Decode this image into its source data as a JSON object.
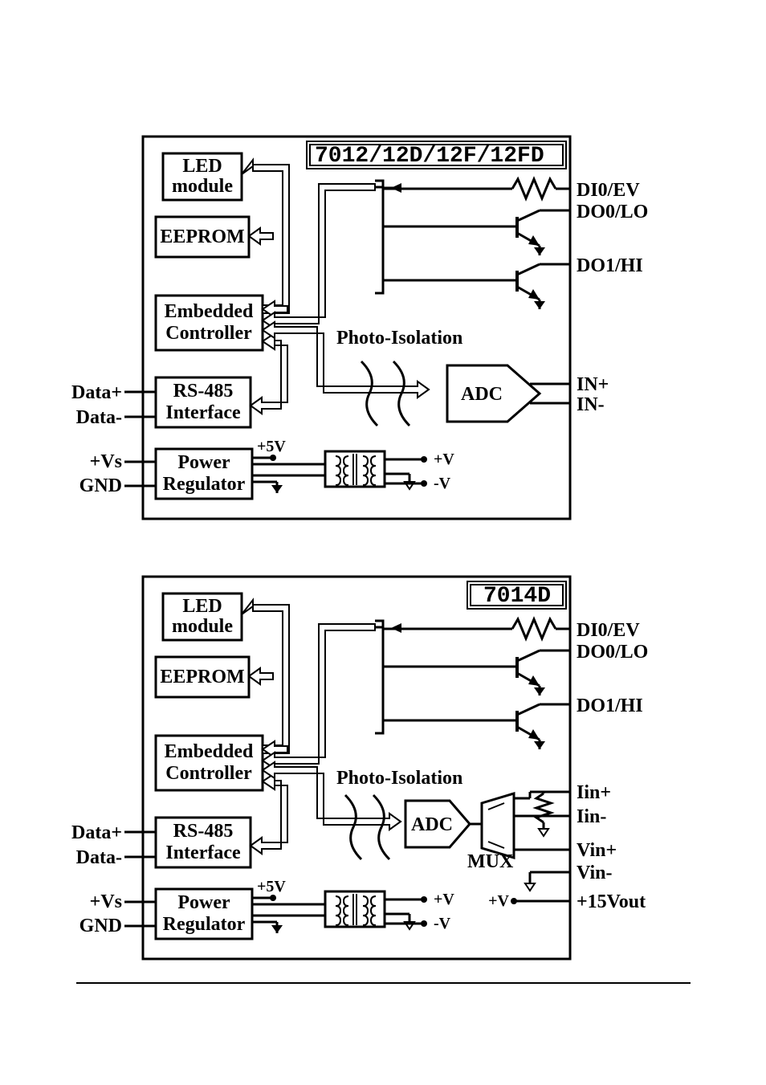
{
  "diagram1": {
    "title": "7012/12D/12F/12FD",
    "blocks": {
      "led": [
        "LED",
        "module"
      ],
      "eeprom": "EEPROM",
      "embedded": [
        "Embedded",
        "Controller"
      ],
      "rs485": [
        "RS-485",
        "Interface"
      ],
      "power": [
        "Power",
        "Regulator"
      ],
      "adc": "ADC",
      "photo": "Photo-Isolation"
    },
    "signals_left": {
      "data_p": "Data+",
      "data_n": "Data-",
      "vs_p": "+Vs",
      "gnd": "GND"
    },
    "signals_right": {
      "di0": "DI0/EV",
      "do0": "DO0/LO",
      "do1": "DO1/HI",
      "in_p": "IN+",
      "in_n": "IN-"
    },
    "pwr": {
      "v5": "+5V",
      "vp": "+V",
      "vn": "-V"
    }
  },
  "diagram2": {
    "title": "7014D",
    "blocks": {
      "led": [
        "LED",
        "module"
      ],
      "eeprom": "EEPROM",
      "embedded": [
        "Embedded",
        "Controller"
      ],
      "rs485": [
        "RS-485",
        "Interface"
      ],
      "power": [
        "Power",
        "Regulator"
      ],
      "adc": "ADC",
      "mux": "MUX",
      "photo": "Photo-Isolation"
    },
    "signals_left": {
      "data_p": "Data+",
      "data_n": "Data-",
      "vs_p": "+Vs",
      "gnd": "GND"
    },
    "signals_right": {
      "di0": "DI0/EV",
      "do0": "DO0/LO",
      "do1": "DO1/HI",
      "iin_p": "Iin+",
      "iin_n": "Iin-",
      "vin_p": "Vin+",
      "vin_n": "Vin-",
      "v15out": "+15Vout",
      "vplus": "+V"
    },
    "pwr": {
      "v5": "+5V",
      "vp": "+V",
      "vn": "-V"
    }
  }
}
